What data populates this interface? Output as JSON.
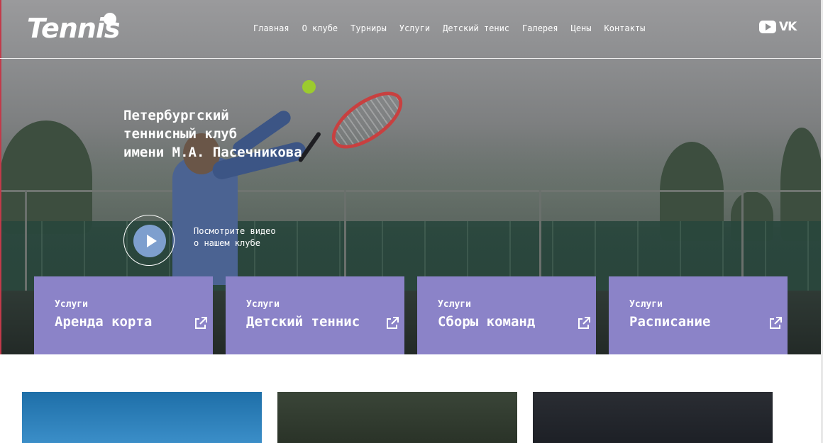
{
  "header": {
    "logo": "Tennis",
    "nav": [
      "Главная",
      "О клубе",
      "Турниры",
      "Услуги",
      "Детский тенис",
      "Галерея",
      "Цены",
      "Контакты"
    ],
    "social": {
      "vk": "VK"
    }
  },
  "hero": {
    "title_lines": [
      "Петербургский",
      "теннисный клуб",
      "имени М.А. Пасечникова"
    ],
    "video_lines": [
      "Посмотрите видео",
      "о нашем клубе"
    ]
  },
  "cards": [
    {
      "kicker": "Услуги",
      "title": "Аренда корта"
    },
    {
      "kicker": "Услуги",
      "title": "Детский теннис"
    },
    {
      "kicker": "Услуги",
      "title": "Сборы команд"
    },
    {
      "kicker": "Услуги",
      "title": "Расписание"
    }
  ],
  "colors": {
    "card_bg": "#8b83c8",
    "play_button": "#7e9fce",
    "accent_left": "#c23a4a"
  }
}
